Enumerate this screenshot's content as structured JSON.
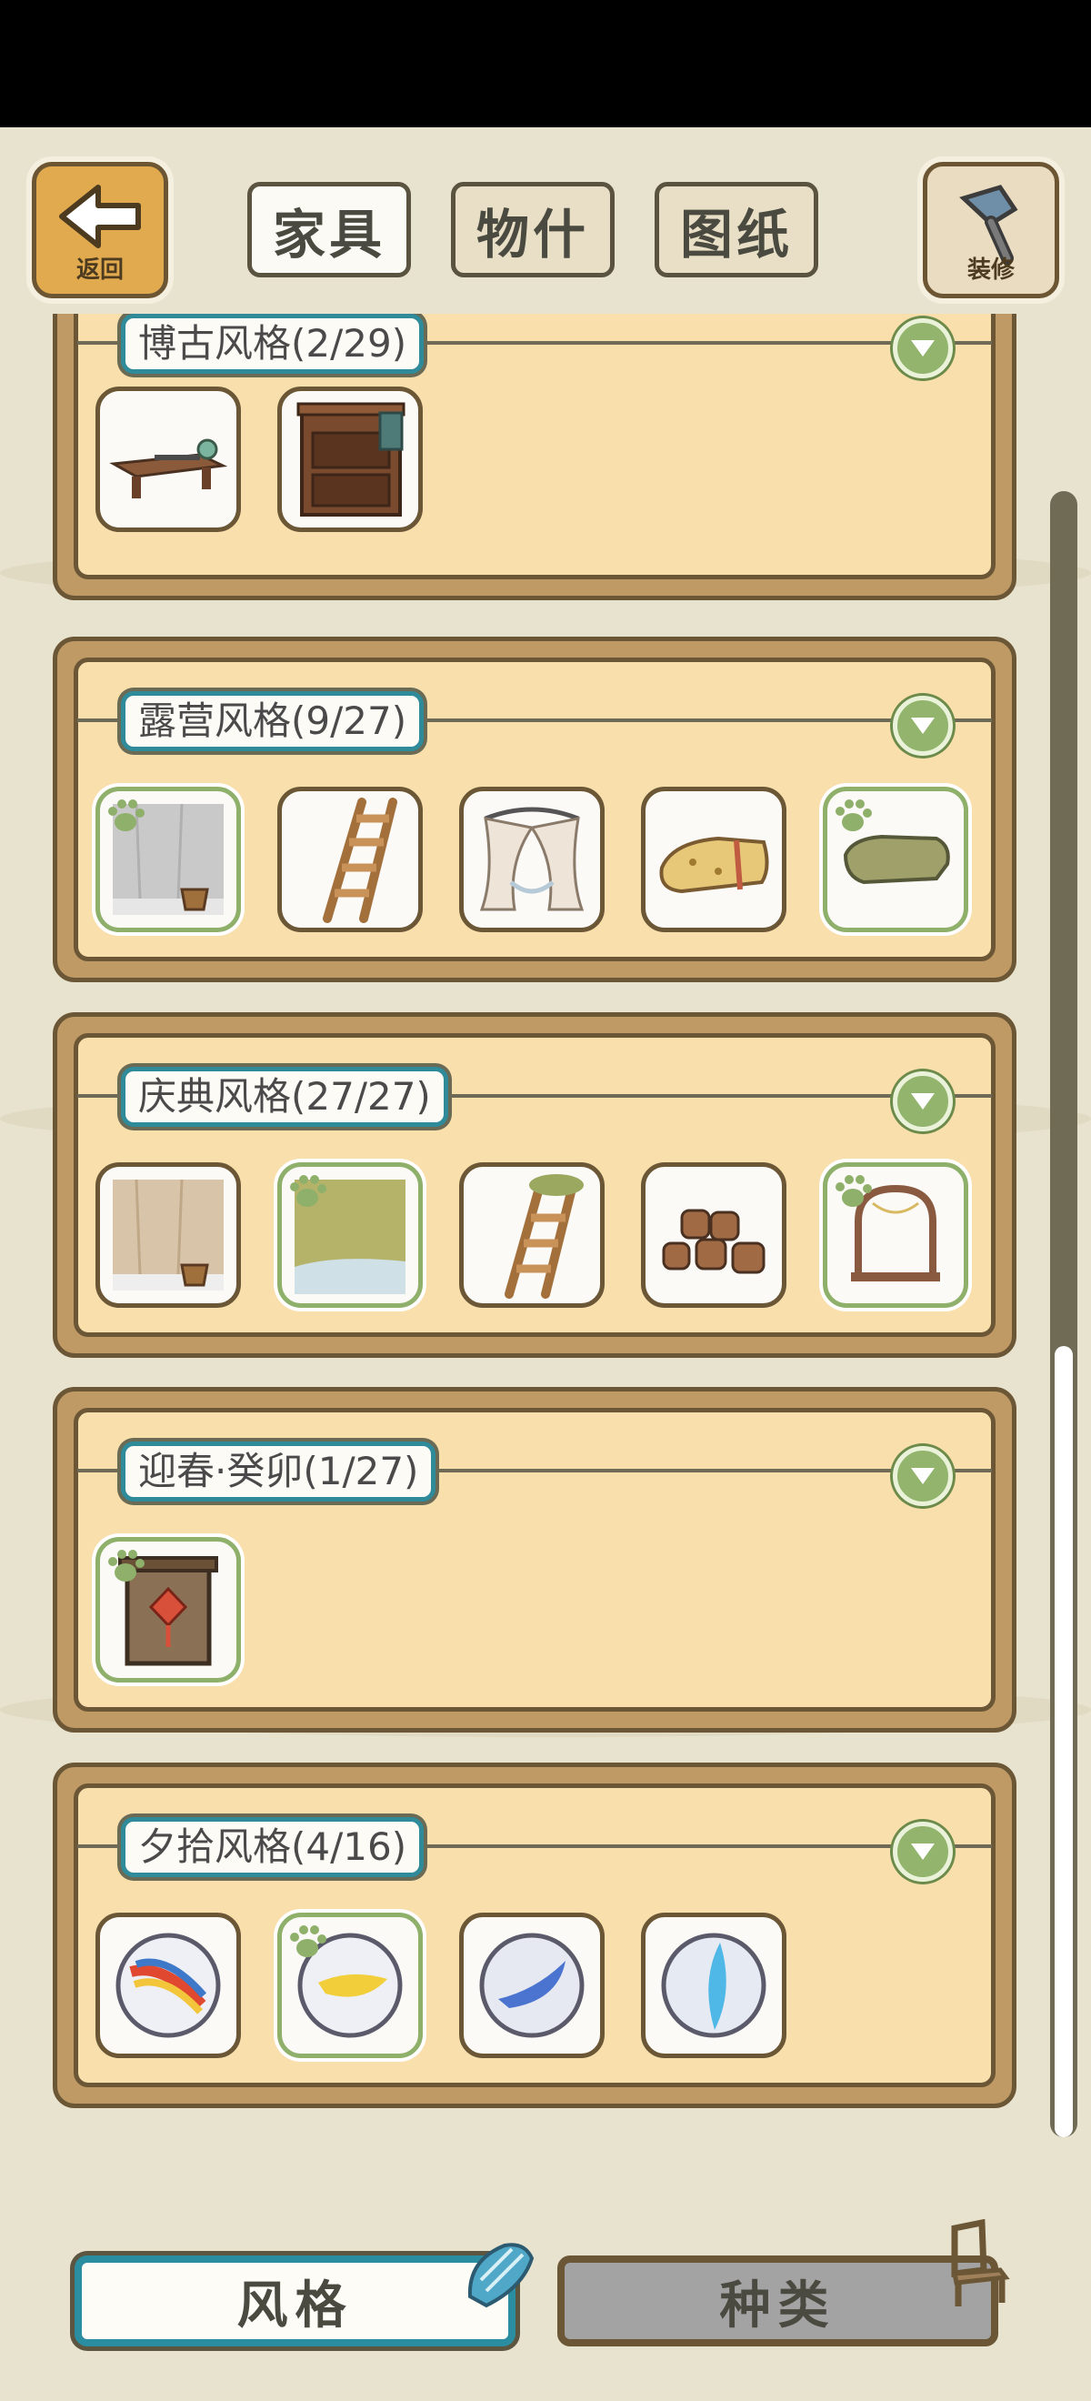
{
  "colors": {
    "background": "#e8e3cf",
    "panel_outer": "#c09a65",
    "panel_inner": "#f9dfac",
    "panel_border": "#6b5636",
    "title_border": "#2f8a99",
    "owned_border": "#8fb06a",
    "chevron": "#93b46c",
    "active_tab_border": "#2b8ea0",
    "inactive_tab": "#a3a3a3"
  },
  "header": {
    "back": {
      "label": "返回",
      "icon": "arrow-left-icon"
    },
    "tabs": [
      {
        "label": "家具",
        "active": true
      },
      {
        "label": "物什",
        "active": false
      },
      {
        "label": "图纸",
        "active": false
      }
    ],
    "decorate": {
      "label": "装修",
      "icon": "hammer-icon"
    }
  },
  "categories": [
    {
      "title": "博古风格(2/29)",
      "items": [
        {
          "icon": "low-table-icon",
          "owned": false
        },
        {
          "icon": "wooden-cabinet-icon",
          "owned": false
        }
      ]
    },
    {
      "title": "露营风格(9/27)",
      "items": [
        {
          "icon": "wall-with-bucket-icon",
          "owned": true
        },
        {
          "icon": "ladder-icon",
          "owned": false
        },
        {
          "icon": "tent-canopy-icon",
          "owned": false
        },
        {
          "icon": "sleeping-bag-icon",
          "owned": false
        },
        {
          "icon": "cushion-icon",
          "owned": true
        }
      ]
    },
    {
      "title": "庆典风格(27/27)",
      "items": [
        {
          "icon": "wall-with-bucket-icon",
          "owned": false
        },
        {
          "icon": "grass-floor-icon",
          "owned": true
        },
        {
          "icon": "mossy-ladder-icon",
          "owned": false
        },
        {
          "icon": "barrels-icon",
          "owned": false
        },
        {
          "icon": "arched-window-icon",
          "owned": true
        }
      ]
    },
    {
      "title": "迎春·癸卯(1/27)",
      "items": [
        {
          "icon": "red-knot-door-icon",
          "owned": true
        }
      ]
    },
    {
      "title": "夕拾风格(4/16)",
      "items": [
        {
          "icon": "marble-rainbow-icon",
          "owned": false
        },
        {
          "icon": "marble-yellow-icon",
          "owned": true
        },
        {
          "icon": "marble-blue-icon",
          "owned": false
        },
        {
          "icon": "marble-cyan-icon",
          "owned": false
        }
      ]
    }
  ],
  "bottom": {
    "style_tab": {
      "label": "风格",
      "active": true,
      "icon": "shell-icon"
    },
    "kind_tab": {
      "label": "种类",
      "active": false,
      "icon": "chair-icon"
    }
  }
}
